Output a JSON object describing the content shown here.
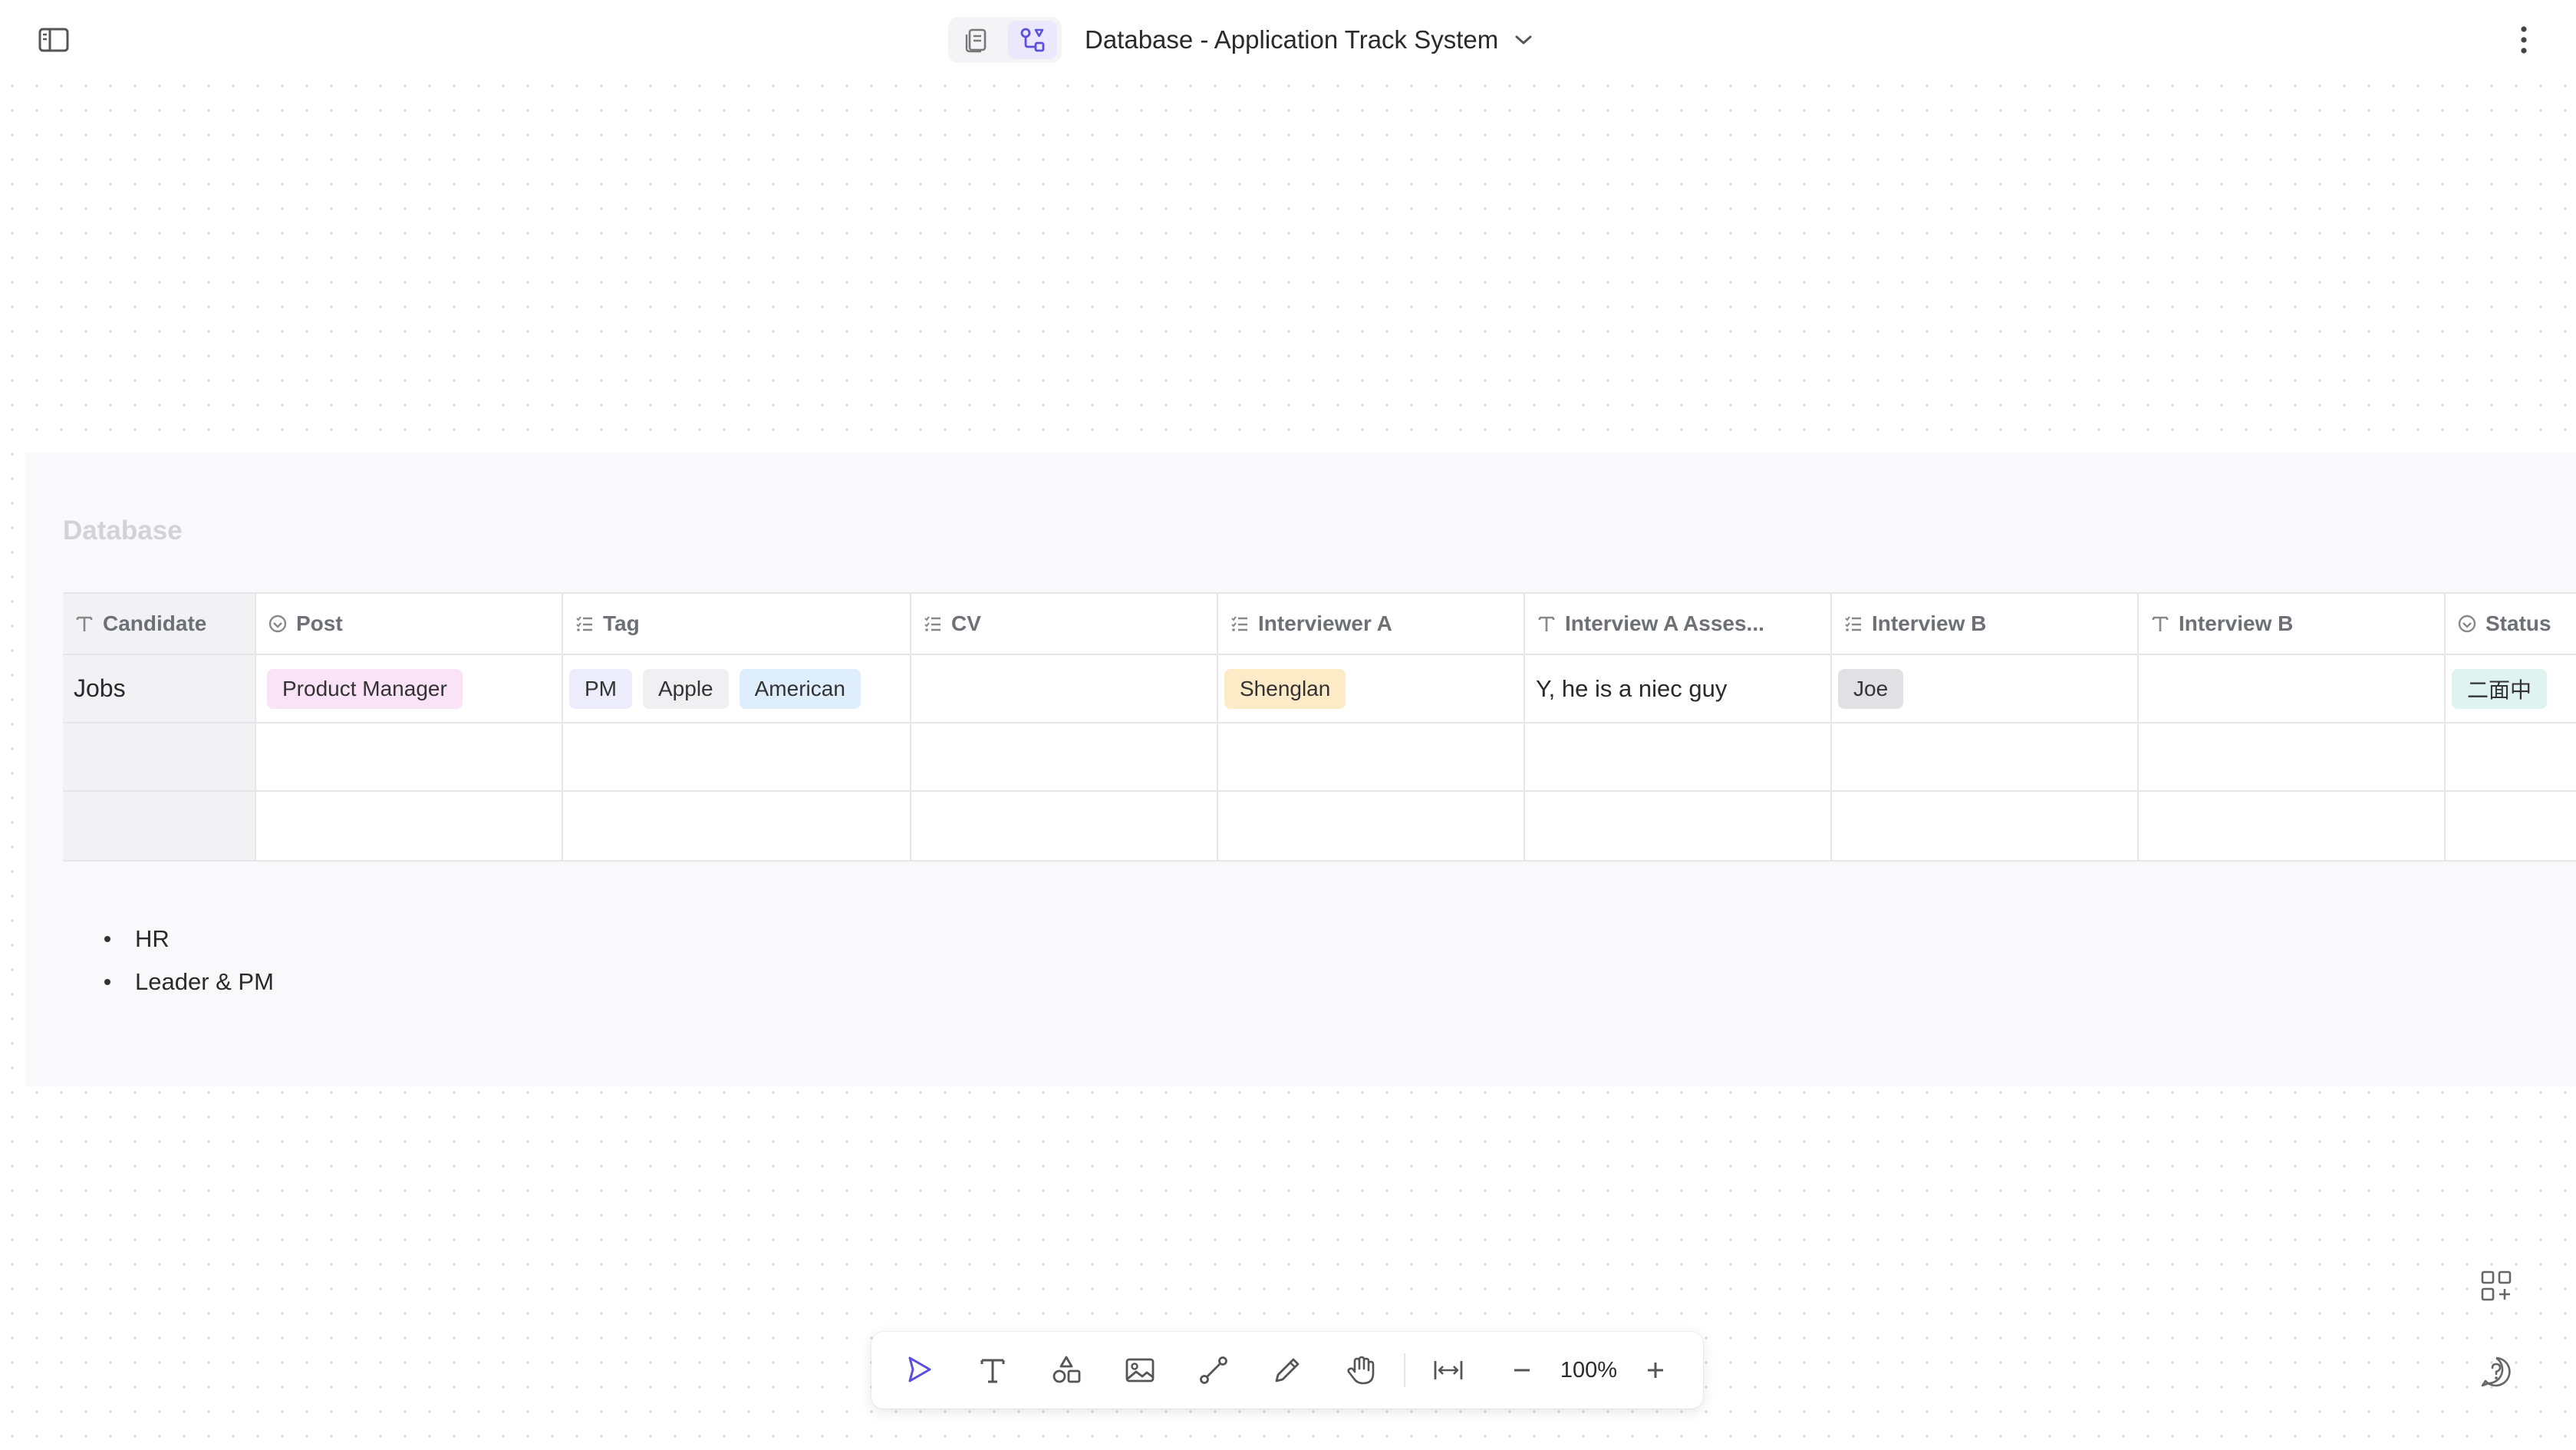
{
  "header": {
    "title": "Database - Application Track System",
    "modes": [
      "page-mode",
      "edgeless-mode"
    ],
    "active_mode": "edgeless-mode"
  },
  "database": {
    "title": "Database",
    "columns": [
      {
        "label": "Candidate",
        "icon": "text-icon"
      },
      {
        "label": "Post",
        "icon": "select-icon"
      },
      {
        "label": "Tag",
        "icon": "multi-select-icon"
      },
      {
        "label": "CV",
        "icon": "multi-select-icon"
      },
      {
        "label": "Interviewer A",
        "icon": "multi-select-icon"
      },
      {
        "label": "Interview A Asses...",
        "icon": "text-icon"
      },
      {
        "label": "Interview B",
        "icon": "multi-select-icon"
      },
      {
        "label": "Interview B",
        "icon": "text-icon"
      },
      {
        "label": "Status",
        "icon": "select-icon"
      }
    ],
    "rows": [
      {
        "candidate": "Jobs",
        "post": {
          "label": "Product Manager",
          "color": "#fbe3f7"
        },
        "tags": [
          {
            "label": "PM",
            "color": "#ececfb"
          },
          {
            "label": "Apple",
            "color": "#f0f0f2"
          },
          {
            "label": "American",
            "color": "#dfeefc"
          }
        ],
        "cv": "",
        "interviewer_a": {
          "label": "Shenglan",
          "color": "#fdebc8"
        },
        "interview_a_assessment": "Y, he is a niec guy",
        "interview_b": {
          "label": "Joe",
          "color": "#e1e1e4"
        },
        "interview_b_text": "",
        "status": {
          "label": "二面中",
          "color": "#dff3f1"
        }
      },
      {
        "candidate": ""
      },
      {
        "candidate": ""
      }
    ]
  },
  "notes": [
    "HR",
    "Leader & PM"
  ],
  "toolbar": {
    "tools": [
      "pointer-icon",
      "text-tool-icon",
      "shapes-icon",
      "image-icon",
      "connector-icon",
      "pen-icon",
      "hand-icon"
    ],
    "zoom": "100%",
    "accent": "#5b4fe0"
  }
}
